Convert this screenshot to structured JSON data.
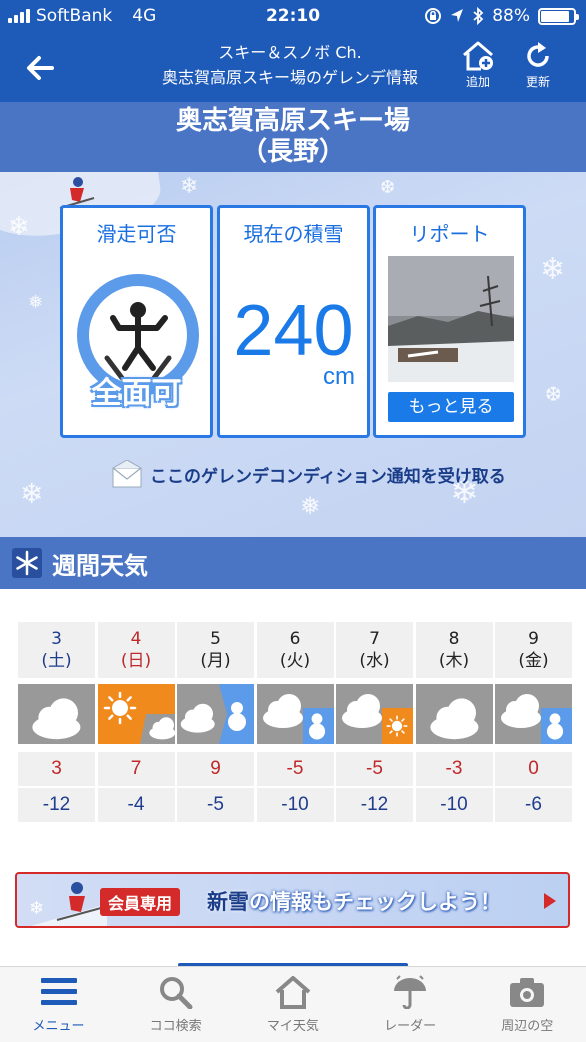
{
  "status_bar": {
    "carrier": "SoftBank",
    "network": "4G",
    "time": "22:10",
    "battery": "88%",
    "battery_level": 0.88
  },
  "header": {
    "back_icon": "arrow-left-icon",
    "line1": "スキー＆スノボ Ch.",
    "line2": "奥志賀高原スキー場のゲレンデ情報",
    "add_label": "追加",
    "refresh_label": "更新"
  },
  "resort": {
    "name": "奥志賀高原スキー場",
    "region": "（長野）"
  },
  "cards": {
    "availability_title": "滑走可否",
    "availability_value": "全面可",
    "snow_title": "現在の積雪",
    "snow_depth": "240",
    "snow_unit": "cm",
    "report_title": "リポート",
    "report_more": "もっと見る"
  },
  "notify_text": "ここのゲレンデコンディション通知を受け取る",
  "weekly": {
    "heading": "週間天気",
    "days": [
      {
        "date": "3",
        "dow": "(土)",
        "dow_color": "#1f3d8f",
        "icon": "cloudy",
        "hi": "3",
        "lo": "-12"
      },
      {
        "date": "4",
        "dow": "(日)",
        "dow_color": "#c0282a",
        "icon": "sunny-then-cloudy",
        "hi": "7",
        "lo": "-4"
      },
      {
        "date": "5",
        "dow": "(月)",
        "dow_color": "#222222",
        "icon": "cloudy-then-snow",
        "hi": "9",
        "lo": "-5"
      },
      {
        "date": "6",
        "dow": "(火)",
        "dow_color": "#222222",
        "icon": "cloudy-occasional-snow",
        "hi": "-5",
        "lo": "-10"
      },
      {
        "date": "7",
        "dow": "(水)",
        "dow_color": "#222222",
        "icon": "cloudy-then-sunny",
        "hi": "-5",
        "lo": "-12"
      },
      {
        "date": "8",
        "dow": "(木)",
        "dow_color": "#222222",
        "icon": "cloudy",
        "hi": "-3",
        "lo": "-10"
      },
      {
        "date": "9",
        "dow": "(金)",
        "dow_color": "#222222",
        "icon": "cloudy-occasional-snow",
        "hi": "0",
        "lo": "-6"
      }
    ]
  },
  "banner": {
    "badge": "会員専用",
    "text_highlight": "新雪",
    "text_rest": "の情報もチェックしよう！"
  },
  "tabs": [
    {
      "label": "メニュー",
      "icon": "menu-icon",
      "active": true
    },
    {
      "label": "ココ検索",
      "icon": "search-icon",
      "active": false
    },
    {
      "label": "マイ天気",
      "icon": "home-icon",
      "active": false
    },
    {
      "label": "レーダー",
      "icon": "radar-umbrella-icon",
      "active": false
    },
    {
      "label": "周辺の空",
      "icon": "camera-icon",
      "active": false
    }
  ],
  "colors": {
    "brand_blue": "#1e5ab8",
    "accent_blue": "#1a7ae8",
    "sun_orange": "#f08a1c",
    "snow_blue": "#5b9bea",
    "red": "#d52a2a"
  }
}
